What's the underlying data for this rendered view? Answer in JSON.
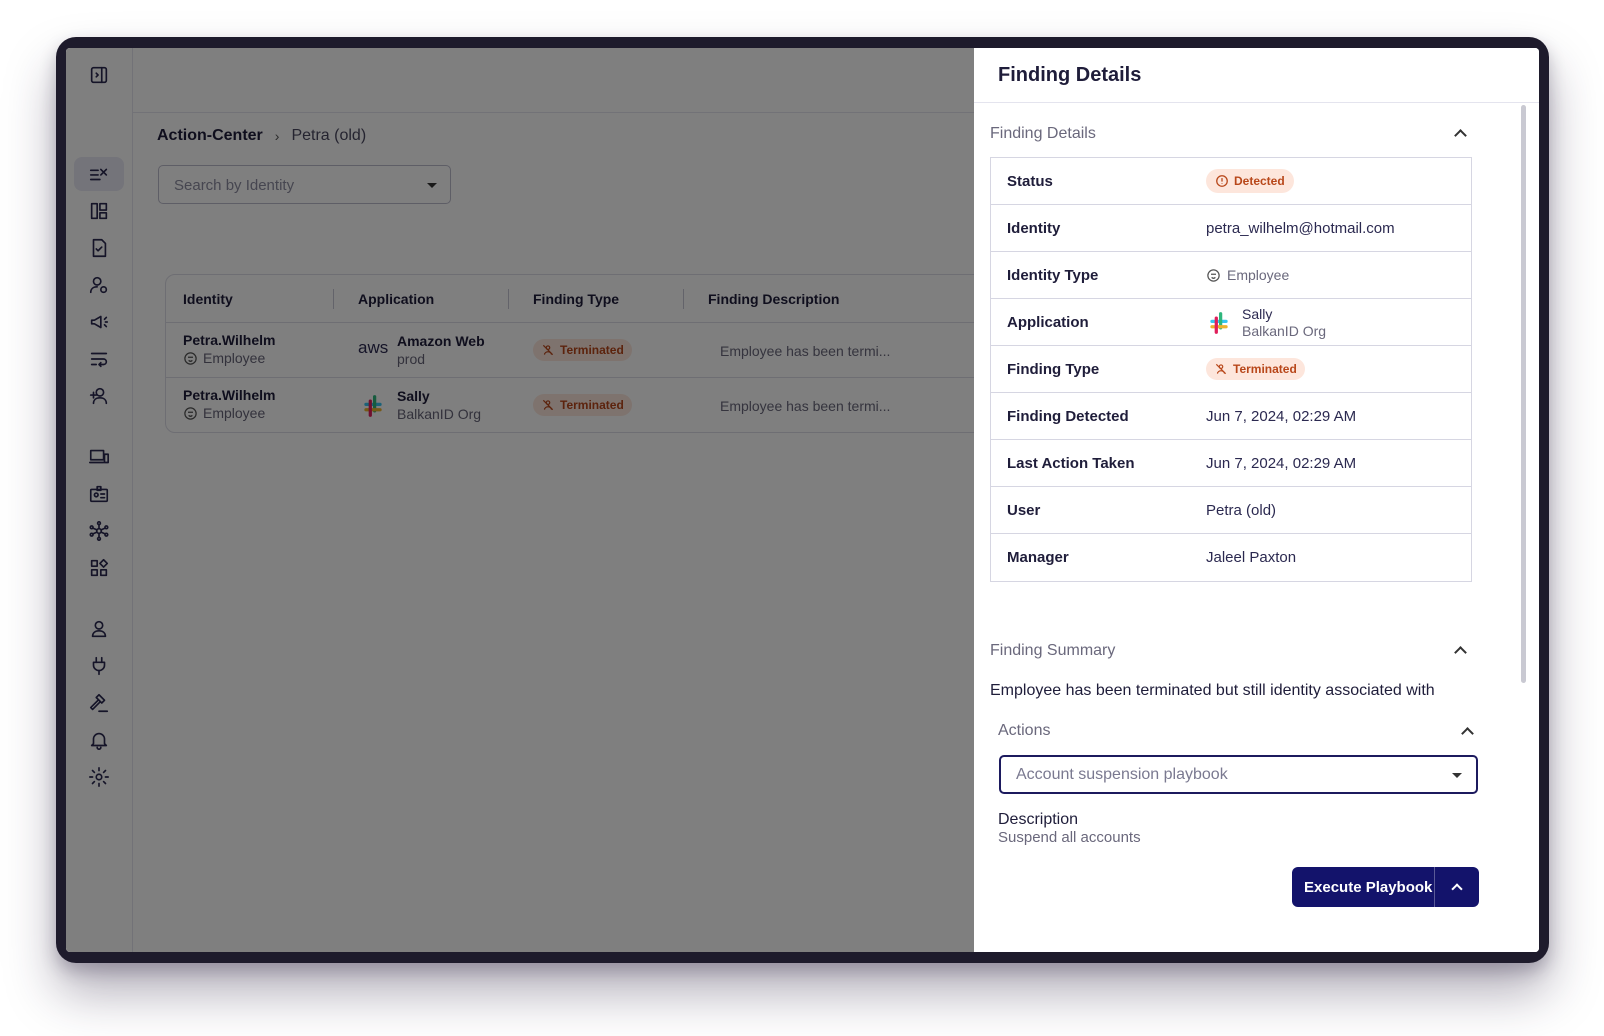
{
  "breadcrumb": {
    "root": "Action-Center",
    "current": "Petra (old)"
  },
  "search": {
    "placeholder": "Search by Identity"
  },
  "table": {
    "headers": [
      "Identity",
      "Application",
      "Finding Type",
      "Finding Description"
    ],
    "rows": [
      {
        "identity": "Petra.Wilhelm",
        "identity_type": "Employee",
        "app_icon": "aws-logo",
        "app_logo_text": "aws",
        "app_name": "Amazon Web",
        "app_sub": "prod",
        "finding_type": "Terminated",
        "description": "Employee has been termi..."
      },
      {
        "identity": "Petra.Wilhelm",
        "identity_type": "Employee",
        "app_icon": "slack-logo",
        "app_name": "Sally",
        "app_sub": "BalkanID Org",
        "finding_type": "Terminated",
        "description": "Employee has been termi..."
      }
    ]
  },
  "drawer": {
    "title": "Finding Details",
    "details_section_title": "Finding Details",
    "details": {
      "status": {
        "label": "Status",
        "value": "Detected"
      },
      "identity": {
        "label": "Identity",
        "value": "petra_wilhelm@hotmail.com"
      },
      "identity_type": {
        "label": "Identity Type",
        "value": "Employee"
      },
      "application": {
        "label": "Application",
        "name": "Sally",
        "sub": "BalkanID Org"
      },
      "finding_type": {
        "label": "Finding Type",
        "value": "Terminated"
      },
      "finding_detected": {
        "label": "Finding Detected",
        "value": "Jun 7, 2024, 02:29 AM"
      },
      "last_action": {
        "label": "Last Action Taken",
        "value": "Jun 7, 2024, 02:29 AM"
      },
      "user": {
        "label": "User",
        "value": "Petra (old)"
      },
      "manager": {
        "label": "Manager",
        "value": "Jaleel Paxton"
      }
    },
    "summary_section_title": "Finding Summary",
    "summary_text": "Employee has been terminated but still identity associated with",
    "actions_section_title": "Actions",
    "playbook_select": "Account suspension playbook",
    "description_label": "Description",
    "description_value": "Suspend all accounts",
    "execute_label": "Execute Playbook"
  },
  "colors": {
    "primary": "#13136b",
    "badge_bg": "#fde6dc",
    "badge_text": "#b8471a"
  }
}
